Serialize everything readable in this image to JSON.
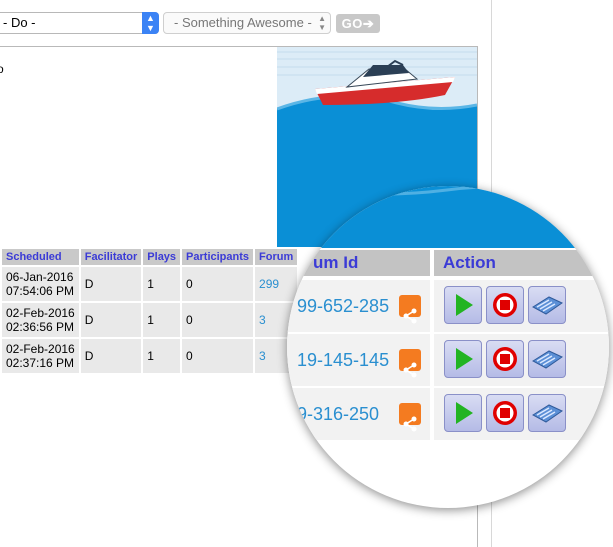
{
  "toolbar": {
    "select1_value": "- Do -",
    "select2_value": "- Something Awesome -",
    "go_label": "GO"
  },
  "stub_text": "o",
  "table": {
    "headers": [
      "Scheduled",
      "Facilitator",
      "Plays",
      "Participants",
      "Forum"
    ],
    "rows": [
      {
        "scheduled_date": "06-Jan-2016",
        "scheduled_time": "07:54:06 PM",
        "facilitator": "D",
        "plays": "1",
        "participants": "0",
        "forum": "299"
      },
      {
        "scheduled_date": "02-Feb-2016",
        "scheduled_time": "02:36:56 PM",
        "facilitator": "D",
        "plays": "1",
        "participants": "0",
        "forum": "3"
      },
      {
        "scheduled_date": "02-Feb-2016",
        "scheduled_time": "02:37:16 PM",
        "facilitator": "D",
        "plays": "1",
        "participants": "0",
        "forum": "3"
      }
    ]
  },
  "magnifier": {
    "forum_header": "um Id",
    "action_header": "Action",
    "rows": [
      {
        "forum_id": "99-652-285"
      },
      {
        "forum_id": "19-145-145"
      },
      {
        "forum_id": "9-316-250"
      }
    ]
  },
  "icons": {
    "select_arrows": "updown-chevron-icon",
    "go_arrow": "arrow-right-icon",
    "share": "share-icon",
    "play": "play-icon",
    "stop": "stop-icon",
    "keyboard": "keyboard-icon"
  },
  "colors": {
    "select_accent": "#3b83f5",
    "header_text": "#3b3bd6",
    "link": "#2a8fd0",
    "share_bg": "#f47b20",
    "play_green": "#22b422",
    "stop_red": "#e00000",
    "sea": "#0a8fd6"
  }
}
